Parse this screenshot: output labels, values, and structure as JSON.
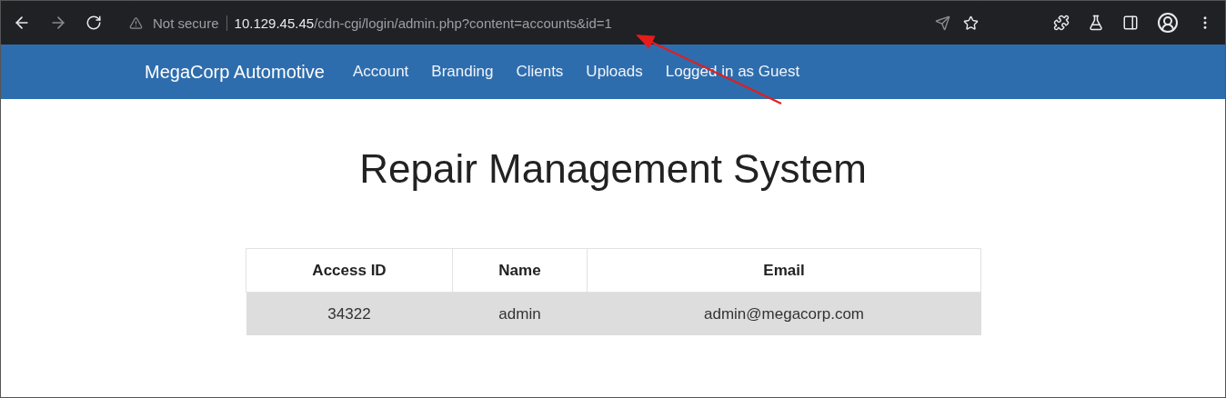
{
  "browser": {
    "security": "Not secure",
    "url_host": "10.129.45.45",
    "url_path": "/cdn-cgi/login/admin.php?content=accounts&id=1"
  },
  "navbar": {
    "brand": "MegaCorp Automotive",
    "links": [
      "Account",
      "Branding",
      "Clients",
      "Uploads",
      "Logged in as Guest"
    ]
  },
  "heading": "Repair Management System",
  "table": {
    "columns": [
      "Access ID",
      "Name",
      "Email"
    ],
    "rows": [
      [
        "34322",
        "admin",
        "admin@megacorp.com"
      ]
    ]
  }
}
